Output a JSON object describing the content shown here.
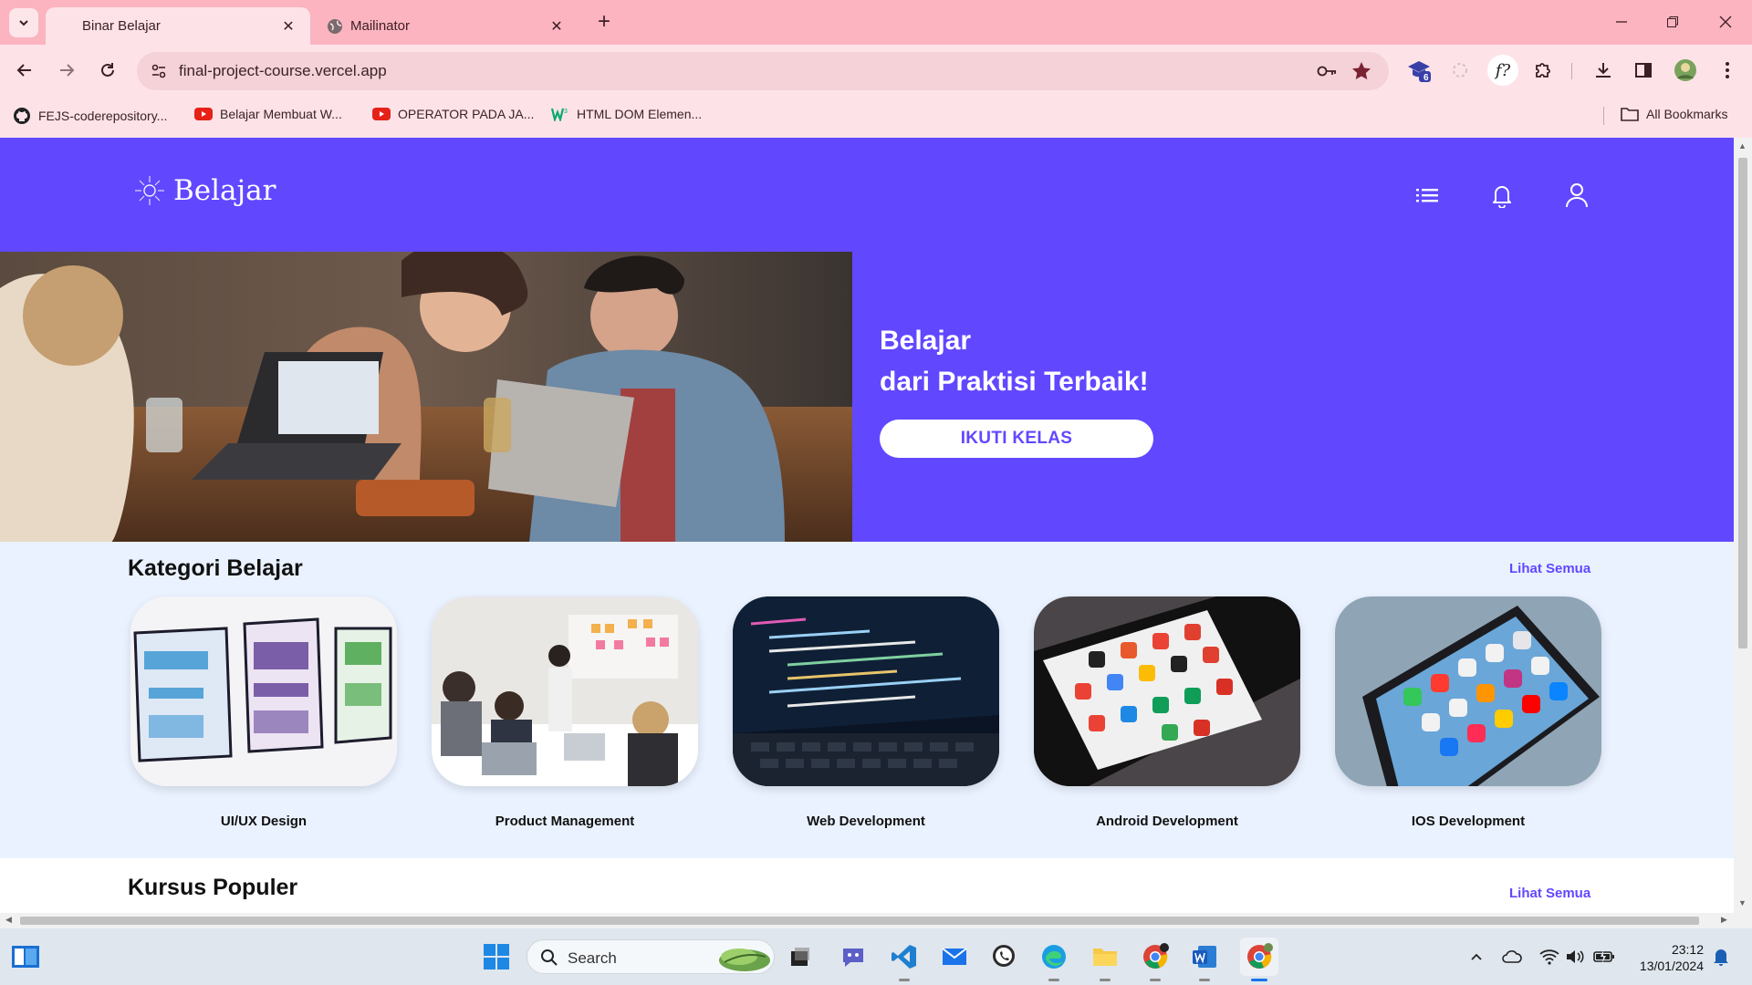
{
  "browser": {
    "tabs": [
      {
        "title": "Binar Belajar",
        "active": true
      },
      {
        "title": "Mailinator",
        "active": false
      }
    ],
    "url": "final-project-course.vercel.app",
    "bookmarks": [
      {
        "label": "FEJS-coderepository...",
        "icon": "github-icon"
      },
      {
        "label": "Belajar Membuat W...",
        "icon": "youtube-icon"
      },
      {
        "label": "OPERATOR PADA JA...",
        "icon": "youtube-icon"
      },
      {
        "label": "HTML DOM Elemen...",
        "icon": "w3schools-icon"
      }
    ],
    "all_bookmarks": "All Bookmarks",
    "extension_badge": "6",
    "extension_f_label": "f?"
  },
  "site": {
    "brand": "Belajar",
    "hero": {
      "line1": "Belajar",
      "line2": "dari Praktisi Terbaik!",
      "cta": "IKUTI KELAS"
    },
    "kategori": {
      "title": "Kategori Belajar",
      "see_all": "Lihat Semua",
      "items": [
        {
          "label": "UI/UX Design"
        },
        {
          "label": "Product Management"
        },
        {
          "label": "Web Development"
        },
        {
          "label": "Android Development"
        },
        {
          "label": "IOS Development"
        }
      ]
    },
    "populer": {
      "title": "Kursus Populer",
      "see_all": "Lihat Semua"
    },
    "colors": {
      "primary": "#6148ff",
      "section_bg": "#eaf2ff"
    }
  },
  "taskbar": {
    "search_placeholder": "Search",
    "time": "23:12",
    "date": "13/01/2024"
  }
}
